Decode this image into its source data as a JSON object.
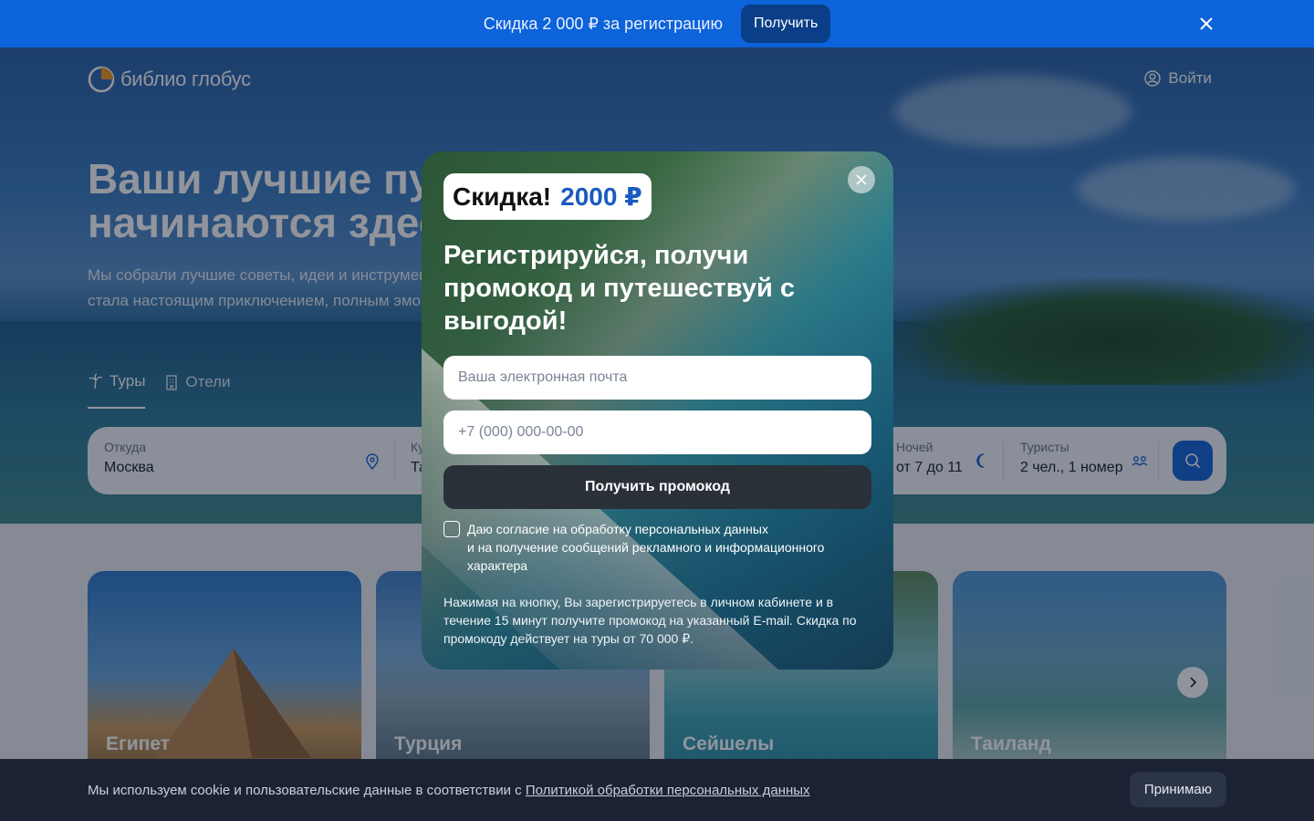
{
  "promo": {
    "text": "Скидка 2 000 ₽ за регистрацию",
    "button": "Получить"
  },
  "header": {
    "logo_text": "библио глобус",
    "login": "Войти"
  },
  "hero": {
    "title_line1": "Ваши лучшие путешествия",
    "title_line2": "начинаются здесь",
    "subtitle_line1": "Мы собрали лучшие советы, идеи и инструменты, чтобы каждая поездка",
    "subtitle_line2": "стала настоящим приключением, полным эмоций"
  },
  "tabs": [
    {
      "label": "Туры"
    },
    {
      "label": "Отели"
    }
  ],
  "search": {
    "from_label": "Откуда",
    "from_value": "Москва",
    "to_label": "Ку",
    "to_value": "Та",
    "nights_label": "Ночей",
    "nights_value": "от 7 до 11",
    "tourists_label": "Туристы",
    "tourists_value": "2 чел., 1 номер"
  },
  "destinations": [
    {
      "name": "Египет"
    },
    {
      "name": "Турция"
    },
    {
      "name": "Сейшелы"
    },
    {
      "name": "Таиланд"
    }
  ],
  "modal": {
    "badge_text": "Скидка!",
    "badge_amount": "2000 ₽",
    "title": "Регистрируйся, получи промокод и путешествуй с выгодой!",
    "email_placeholder": "Ваша электронная почта",
    "phone_placeholder": "+7 (000) 000-00-00",
    "submit": "Получить промокод",
    "consent_line1": "Даю согласие на обработку персональных данных",
    "consent_line2": "и на получение сообщений рекламного и информационного характера",
    "note": "Нажимая на кнопку, Вы зарегистрируетесь в личном кабинете и в течение 15 минут получите промокод на указанный E-mail. Скидка по промокоду действует на туры от 70 000 ₽."
  },
  "cookie": {
    "text": "Мы используем cookie и пользовательские данные в соответствии с ",
    "link": "Политикой обработки персональных данных",
    "accept": "Принимаю"
  }
}
